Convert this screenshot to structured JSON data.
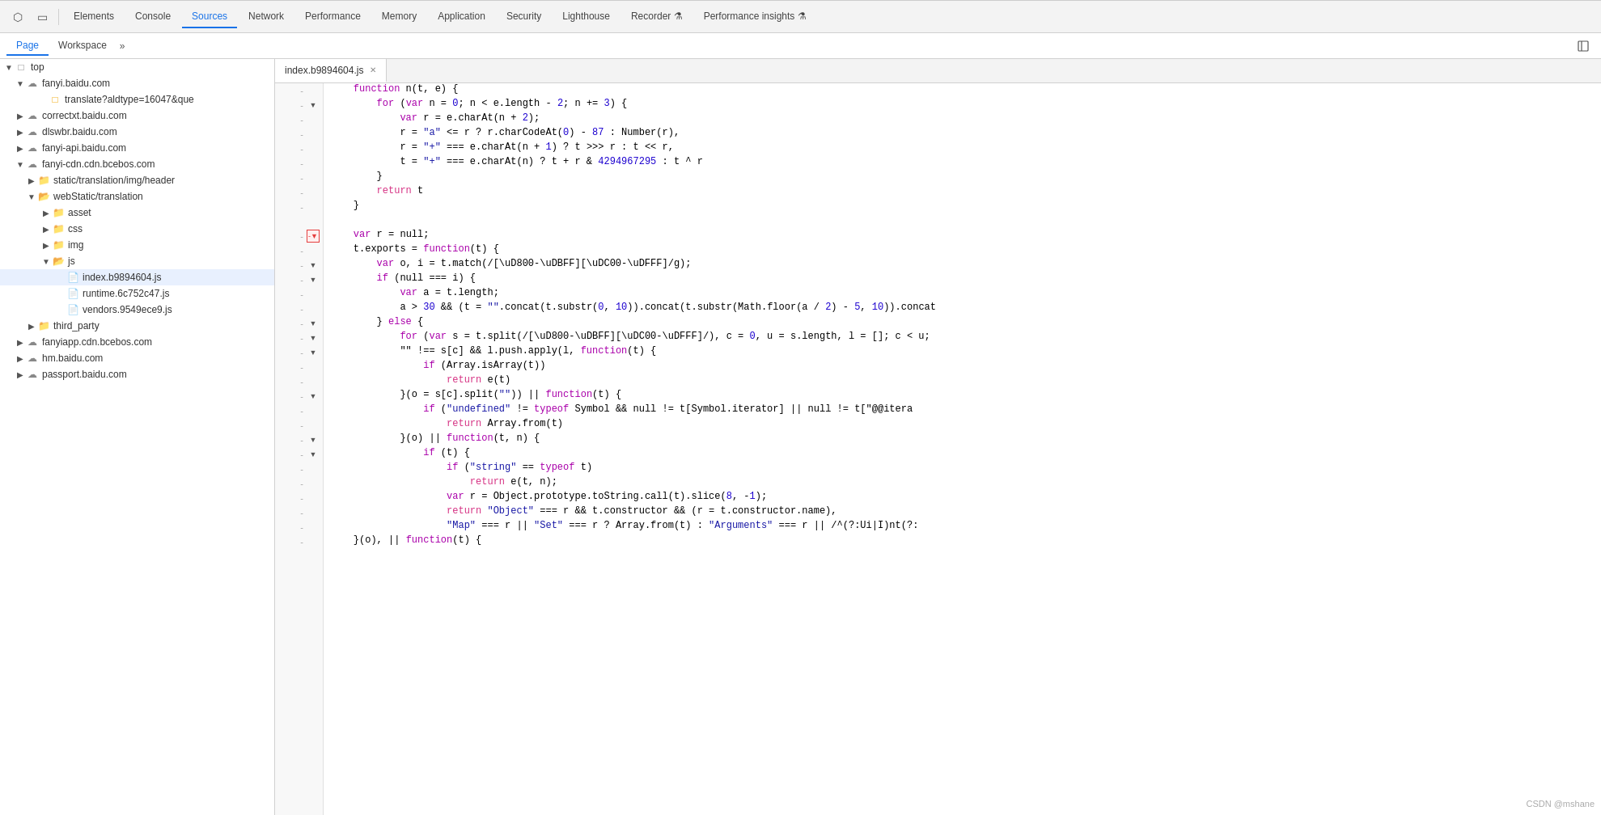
{
  "devtools": {
    "top_tabs": [
      {
        "label": "Elements",
        "active": false
      },
      {
        "label": "Console",
        "active": false
      },
      {
        "label": "Sources",
        "active": true
      },
      {
        "label": "Network",
        "active": false
      },
      {
        "label": "Performance",
        "active": false
      },
      {
        "label": "Memory",
        "active": false
      },
      {
        "label": "Application",
        "active": false
      },
      {
        "label": "Security",
        "active": false
      },
      {
        "label": "Lighthouse",
        "active": false
      },
      {
        "label": "Recorder ⚗",
        "active": false
      },
      {
        "label": "Performance insights ⚗",
        "active": false
      }
    ],
    "sub_tabs": [
      {
        "label": "Page",
        "active": true
      },
      {
        "label": "Workspace",
        "active": false
      }
    ],
    "file_tab": {
      "name": "index.b9894604.js",
      "active": true
    },
    "sidebar_tree": [
      {
        "level": 0,
        "type": "top",
        "label": "top",
        "expanded": true
      },
      {
        "level": 1,
        "type": "domain",
        "label": "fanyi.baidu.com",
        "expanded": true
      },
      {
        "level": 2,
        "type": "file",
        "label": "translate?aldtype=16047&que"
      },
      {
        "level": 1,
        "type": "domain",
        "label": "correctxt.baidu.com",
        "expanded": false
      },
      {
        "level": 1,
        "type": "domain",
        "label": "dlswbr.baidu.com",
        "expanded": false
      },
      {
        "level": 1,
        "type": "domain",
        "label": "fanyi-api.baidu.com",
        "expanded": false
      },
      {
        "level": 1,
        "type": "domain",
        "label": "fanyi-cdn.cdn.bcebos.com",
        "expanded": true
      },
      {
        "level": 2,
        "type": "folder",
        "label": "static/translation/img/header",
        "expanded": false
      },
      {
        "level": 2,
        "type": "folder",
        "label": "webStatic/translation",
        "expanded": true
      },
      {
        "level": 3,
        "type": "folder",
        "label": "asset",
        "expanded": false
      },
      {
        "level": 3,
        "type": "folder",
        "label": "css",
        "expanded": false
      },
      {
        "level": 3,
        "type": "folder",
        "label": "img",
        "expanded": false
      },
      {
        "level": 3,
        "type": "folder",
        "label": "js",
        "expanded": true
      },
      {
        "level": 4,
        "type": "file",
        "label": "index.b9894604.js",
        "selected": true
      },
      {
        "level": 4,
        "type": "file",
        "label": "runtime.6c752c47.js"
      },
      {
        "level": 4,
        "type": "file",
        "label": "vendors.9549ece9.js"
      },
      {
        "level": 2,
        "type": "folder",
        "label": "third_party",
        "expanded": false
      },
      {
        "level": 1,
        "type": "domain",
        "label": "fanyiapp.cdn.bcebos.com",
        "expanded": false
      },
      {
        "level": 1,
        "type": "domain",
        "label": "hm.baidu.com",
        "expanded": false
      },
      {
        "level": 1,
        "type": "domain",
        "label": "passport.baidu.com",
        "expanded": false
      }
    ],
    "code_lines": [
      {
        "gutter_dash": true,
        "gutter_collapse": false,
        "highlighted_collapse": false,
        "content": [
          {
            "t": "    ",
            "c": ""
          },
          {
            "t": "function",
            "c": "kw"
          },
          {
            "t": " n(t, e) {",
            "c": ""
          }
        ]
      },
      {
        "gutter_dash": true,
        "gutter_collapse": true,
        "highlighted_collapse": false,
        "content": [
          {
            "t": "        ",
            "c": ""
          },
          {
            "t": "for",
            "c": "kw"
          },
          {
            "t": " (",
            "c": ""
          },
          {
            "t": "var",
            "c": "kw"
          },
          {
            "t": " n = ",
            "c": ""
          },
          {
            "t": "0",
            "c": "num"
          },
          {
            "t": "; n < e.length - ",
            "c": ""
          },
          {
            "t": "2",
            "c": "num"
          },
          {
            "t": "; n += ",
            "c": ""
          },
          {
            "t": "3",
            "c": "num"
          },
          {
            "t": ") {",
            "c": ""
          }
        ]
      },
      {
        "gutter_dash": true,
        "gutter_collapse": false,
        "highlighted_collapse": false,
        "content": [
          {
            "t": "            ",
            "c": ""
          },
          {
            "t": "var",
            "c": "kw"
          },
          {
            "t": " r = e.charAt(n + ",
            "c": ""
          },
          {
            "t": "2",
            "c": "num"
          },
          {
            "t": ");",
            "c": ""
          }
        ]
      },
      {
        "gutter_dash": true,
        "gutter_collapse": false,
        "highlighted_collapse": false,
        "content": [
          {
            "t": "            ",
            "c": ""
          },
          {
            "t": "r = \"a\"",
            "c": "str"
          },
          {
            "t": " <= r ? r.charCodeAt(",
            "c": ""
          },
          {
            "t": "0",
            "c": "num"
          },
          {
            "t": ") - ",
            "c": ""
          },
          {
            "t": "87",
            "c": "num"
          },
          {
            "t": " : Number(r),",
            "c": ""
          }
        ]
      },
      {
        "gutter_dash": true,
        "gutter_collapse": false,
        "highlighted_collapse": false,
        "content": [
          {
            "t": "            ",
            "c": ""
          },
          {
            "t": "r = \"+\"",
            "c": "str"
          },
          {
            "t": " === e.charAt(n + ",
            "c": ""
          },
          {
            "t": "1",
            "c": "num"
          },
          {
            "t": ") ? t >>> r : t << r,",
            "c": ""
          }
        ]
      },
      {
        "gutter_dash": true,
        "gutter_collapse": false,
        "highlighted_collapse": false,
        "content": [
          {
            "t": "            ",
            "c": ""
          },
          {
            "t": "t = \"+\"",
            "c": "str"
          },
          {
            "t": " === e.charAt(n) ? t + r & ",
            "c": ""
          },
          {
            "t": "4294967295",
            "c": "num"
          },
          {
            "t": " : t ^ r",
            "c": ""
          }
        ]
      },
      {
        "gutter_dash": true,
        "gutter_collapse": false,
        "highlighted_collapse": false,
        "content": [
          {
            "t": "        }",
            "c": ""
          }
        ]
      },
      {
        "gutter_dash": true,
        "gutter_collapse": false,
        "highlighted_collapse": false,
        "content": [
          {
            "t": "        ",
            "c": ""
          },
          {
            "t": "return",
            "c": "kw pink"
          },
          {
            "t": " t",
            "c": ""
          }
        ]
      },
      {
        "gutter_dash": true,
        "gutter_collapse": false,
        "highlighted_collapse": false,
        "content": [
          {
            "t": "    }",
            "c": ""
          }
        ]
      },
      {
        "gutter_dash": false,
        "gutter_collapse": false,
        "highlighted_collapse": false,
        "content": []
      },
      {
        "gutter_dash": true,
        "gutter_collapse": true,
        "highlighted_collapse": true,
        "content": [
          {
            "t": "    ",
            "c": ""
          },
          {
            "t": "var",
            "c": "kw"
          },
          {
            "t": " r = null;",
            "c": ""
          }
        ]
      },
      {
        "gutter_dash": true,
        "gutter_collapse": false,
        "highlighted_collapse": false,
        "content": [
          {
            "t": "    t.exports = ",
            "c": ""
          },
          {
            "t": "function",
            "c": "kw"
          },
          {
            "t": "(t) {",
            "c": ""
          }
        ]
      },
      {
        "gutter_dash": true,
        "gutter_collapse": true,
        "highlighted_collapse": false,
        "content": [
          {
            "t": "        ",
            "c": ""
          },
          {
            "t": "var",
            "c": "kw"
          },
          {
            "t": " o, i = t.match(/[\\uD800-\\uDBFF][\\uDC00-\\uDFFF]/g);",
            "c": ""
          }
        ]
      },
      {
        "gutter_dash": true,
        "gutter_collapse": true,
        "highlighted_collapse": false,
        "content": [
          {
            "t": "        ",
            "c": ""
          },
          {
            "t": "if",
            "c": "kw"
          },
          {
            "t": " (null === i) {",
            "c": ""
          }
        ]
      },
      {
        "gutter_dash": true,
        "gutter_collapse": false,
        "highlighted_collapse": false,
        "content": [
          {
            "t": "            ",
            "c": ""
          },
          {
            "t": "var",
            "c": "kw"
          },
          {
            "t": " a = t.length;",
            "c": ""
          }
        ]
      },
      {
        "gutter_dash": true,
        "gutter_collapse": false,
        "highlighted_collapse": false,
        "content": [
          {
            "t": "            ",
            "c": ""
          },
          {
            "t": "a > ",
            "c": ""
          },
          {
            "t": "30",
            "c": "num"
          },
          {
            "t": " && (t = \"\".concat(t.substr(",
            "c": "str"
          },
          {
            "t": "0",
            "c": "num"
          },
          {
            "t": ", ",
            "c": ""
          },
          {
            "t": "10",
            "c": "num"
          },
          {
            "t": ")).concat(t.substr(Math.floor(a / ",
            "c": ""
          },
          {
            "t": "2",
            "c": "num"
          },
          {
            "t": ") - ",
            "c": ""
          },
          {
            "t": "5",
            "c": "num"
          },
          {
            "t": ", ",
            "c": ""
          },
          {
            "t": "10",
            "c": "num"
          },
          {
            "t": ")).concat",
            "c": ""
          }
        ]
      },
      {
        "gutter_dash": true,
        "gutter_collapse": true,
        "highlighted_collapse": false,
        "content": [
          {
            "t": "        } ",
            "c": ""
          },
          {
            "t": "else",
            "c": "kw"
          },
          {
            "t": " {",
            "c": ""
          }
        ]
      },
      {
        "gutter_dash": true,
        "gutter_collapse": true,
        "highlighted_collapse": false,
        "content": [
          {
            "t": "            ",
            "c": ""
          },
          {
            "t": "for",
            "c": "kw"
          },
          {
            "t": " (var s = t.split(/[\\uD800-\\uDBFF][\\uDC00-\\uDFFF]/), c = ",
            "c": ""
          },
          {
            "t": "0",
            "c": "num"
          },
          {
            "t": ", u = s.length, l = []; c < u;",
            "c": ""
          }
        ]
      },
      {
        "gutter_dash": true,
        "gutter_collapse": true,
        "highlighted_collapse": false,
        "content": [
          {
            "t": "            \"\" !== s[c] && l.push.apply(l, ",
            "c": ""
          },
          {
            "t": "function",
            "c": "kw"
          },
          {
            "t": "(t) {",
            "c": ""
          }
        ]
      },
      {
        "gutter_dash": true,
        "gutter_collapse": false,
        "highlighted_collapse": false,
        "content": [
          {
            "t": "                ",
            "c": ""
          },
          {
            "t": "if",
            "c": "kw"
          },
          {
            "t": " (Array.isArray(t))",
            "c": ""
          }
        ]
      },
      {
        "gutter_dash": true,
        "gutter_collapse": false,
        "highlighted_collapse": false,
        "content": [
          {
            "t": "                    ",
            "c": ""
          },
          {
            "t": "return",
            "c": "kw pink"
          },
          {
            "t": " e(t)",
            "c": ""
          }
        ]
      },
      {
        "gutter_dash": true,
        "gutter_collapse": true,
        "highlighted_collapse": false,
        "content": [
          {
            "t": "            }(o = s[c].split(\"\")) || ",
            "c": ""
          },
          {
            "t": "function",
            "c": "kw"
          },
          {
            "t": "(t) {",
            "c": ""
          }
        ]
      },
      {
        "gutter_dash": true,
        "gutter_collapse": false,
        "highlighted_collapse": false,
        "content": [
          {
            "t": "                ",
            "c": ""
          },
          {
            "t": "if",
            "c": "kw"
          },
          {
            "t": " (\"undefined\" != ",
            "c": ""
          },
          {
            "t": "typeof",
            "c": "kw"
          },
          {
            "t": " Symbol && null != t[Symbol.iterator] || null != t[\"@@itera",
            "c": ""
          }
        ]
      },
      {
        "gutter_dash": true,
        "gutter_collapse": false,
        "highlighted_collapse": false,
        "content": [
          {
            "t": "                    ",
            "c": ""
          },
          {
            "t": "return",
            "c": "kw pink"
          },
          {
            "t": " Array.from(t)",
            "c": ""
          }
        ]
      },
      {
        "gutter_dash": true,
        "gutter_collapse": true,
        "highlighted_collapse": false,
        "content": [
          {
            "t": "            }(o) || ",
            "c": ""
          },
          {
            "t": "function",
            "c": "kw"
          },
          {
            "t": "(t, n) {",
            "c": ""
          }
        ]
      },
      {
        "gutter_dash": true,
        "gutter_collapse": true,
        "highlighted_collapse": false,
        "content": [
          {
            "t": "                ",
            "c": ""
          },
          {
            "t": "if",
            "c": "kw"
          },
          {
            "t": " (t) {",
            "c": ""
          }
        ]
      },
      {
        "gutter_dash": true,
        "gutter_collapse": false,
        "highlighted_collapse": false,
        "content": [
          {
            "t": "                    ",
            "c": ""
          },
          {
            "t": "if",
            "c": "kw"
          },
          {
            "t": " (\"string\" == ",
            "c": ""
          },
          {
            "t": "typeof",
            "c": "kw"
          },
          {
            "t": " t)",
            "c": ""
          }
        ]
      },
      {
        "gutter_dash": true,
        "gutter_collapse": false,
        "highlighted_collapse": false,
        "content": [
          {
            "t": "                        ",
            "c": ""
          },
          {
            "t": "return",
            "c": "kw pink"
          },
          {
            "t": " e(t, n);",
            "c": ""
          }
        ]
      },
      {
        "gutter_dash": true,
        "gutter_collapse": false,
        "highlighted_collapse": false,
        "content": [
          {
            "t": "                    ",
            "c": ""
          },
          {
            "t": "var",
            "c": "kw"
          },
          {
            "t": " r = Object.prototype.toString.call(t).slice(",
            "c": ""
          },
          {
            "t": "8",
            "c": "num"
          },
          {
            "t": ", -",
            "c": ""
          },
          {
            "t": "1",
            "c": "num"
          },
          {
            "t": ");",
            "c": ""
          }
        ]
      },
      {
        "gutter_dash": true,
        "gutter_collapse": false,
        "highlighted_collapse": false,
        "content": [
          {
            "t": "                    ",
            "c": ""
          },
          {
            "t": "return",
            "c": "kw pink"
          },
          {
            "t": " \"Object\" === r && t.constructor && (r = t.constructor.name),",
            "c": ""
          }
        ]
      },
      {
        "gutter_dash": true,
        "gutter_collapse": false,
        "highlighted_collapse": false,
        "content": [
          {
            "t": "                    \"Map\" === r || \"Set\" === r ? Array.from(t) : \"Arguments\" === r || /^(?:Ui|I)nt(?:",
            "c": ""
          }
        ]
      },
      {
        "gutter_dash": true,
        "gutter_collapse": false,
        "highlighted_collapse": false,
        "content": [
          {
            "t": "    }(o), || ",
            "c": ""
          },
          {
            "t": "function",
            "c": "kw"
          },
          {
            "t": "(t) {",
            "c": ""
          }
        ]
      }
    ]
  },
  "watermark": "CSDN @mshane"
}
